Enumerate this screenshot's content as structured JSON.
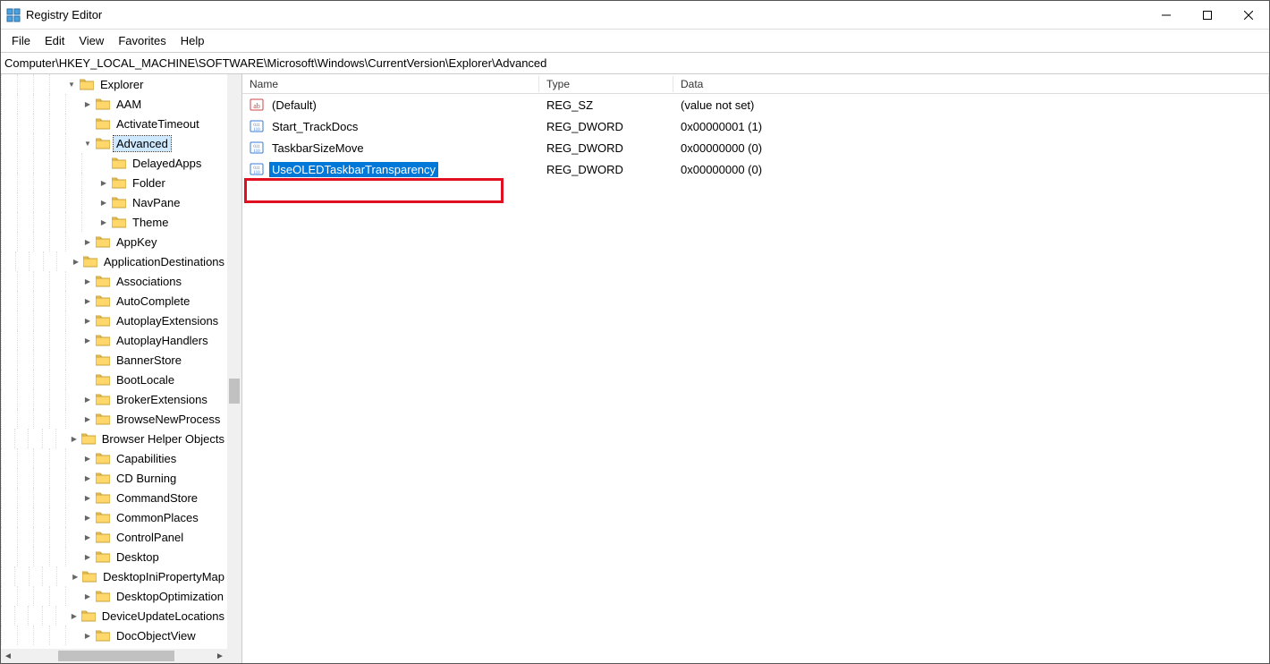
{
  "title": "Registry Editor",
  "menu": {
    "file": "File",
    "edit": "Edit",
    "view": "View",
    "favorites": "Favorites",
    "help": "Help"
  },
  "address": "Computer\\HKEY_LOCAL_MACHINE\\SOFTWARE\\Microsoft\\Windows\\CurrentVersion\\Explorer\\Advanced",
  "columns": {
    "name": "Name",
    "type": "Type",
    "data": "Data"
  },
  "tree": [
    {
      "depth": 4,
      "exp": "v",
      "label": "Explorer",
      "selected": false
    },
    {
      "depth": 5,
      "exp": ">",
      "label": "AAM"
    },
    {
      "depth": 5,
      "exp": "",
      "label": "ActivateTimeout"
    },
    {
      "depth": 5,
      "exp": "v",
      "label": "Advanced",
      "selected": true
    },
    {
      "depth": 6,
      "exp": "",
      "label": "DelayedApps"
    },
    {
      "depth": 6,
      "exp": ">",
      "label": "Folder"
    },
    {
      "depth": 6,
      "exp": ">",
      "label": "NavPane"
    },
    {
      "depth": 6,
      "exp": ">",
      "label": "Theme"
    },
    {
      "depth": 5,
      "exp": ">",
      "label": "AppKey"
    },
    {
      "depth": 5,
      "exp": ">",
      "label": "ApplicationDestinations"
    },
    {
      "depth": 5,
      "exp": ">",
      "label": "Associations"
    },
    {
      "depth": 5,
      "exp": ">",
      "label": "AutoComplete"
    },
    {
      "depth": 5,
      "exp": ">",
      "label": "AutoplayExtensions"
    },
    {
      "depth": 5,
      "exp": ">",
      "label": "AutoplayHandlers"
    },
    {
      "depth": 5,
      "exp": "",
      "label": "BannerStore"
    },
    {
      "depth": 5,
      "exp": "",
      "label": "BootLocale"
    },
    {
      "depth": 5,
      "exp": ">",
      "label": "BrokerExtensions"
    },
    {
      "depth": 5,
      "exp": ">",
      "label": "BrowseNewProcess"
    },
    {
      "depth": 5,
      "exp": ">",
      "label": "Browser Helper Objects"
    },
    {
      "depth": 5,
      "exp": ">",
      "label": "Capabilities"
    },
    {
      "depth": 5,
      "exp": ">",
      "label": "CD Burning"
    },
    {
      "depth": 5,
      "exp": ">",
      "label": "CommandStore"
    },
    {
      "depth": 5,
      "exp": ">",
      "label": "CommonPlaces"
    },
    {
      "depth": 5,
      "exp": ">",
      "label": "ControlPanel"
    },
    {
      "depth": 5,
      "exp": ">",
      "label": "Desktop"
    },
    {
      "depth": 5,
      "exp": ">",
      "label": "DesktopIniPropertyMap"
    },
    {
      "depth": 5,
      "exp": ">",
      "label": "DesktopOptimization"
    },
    {
      "depth": 5,
      "exp": ">",
      "label": "DeviceUpdateLocations"
    },
    {
      "depth": 5,
      "exp": ">",
      "label": "DocObjectView"
    }
  ],
  "values": [
    {
      "name": "(Default)",
      "type": "REG_SZ",
      "data": "(value not set)",
      "icon": "string",
      "selected": false
    },
    {
      "name": "Start_TrackDocs",
      "type": "REG_DWORD",
      "data": "0x00000001 (1)",
      "icon": "binary",
      "selected": false
    },
    {
      "name": "TaskbarSizeMove",
      "type": "REG_DWORD",
      "data": "0x00000000 (0)",
      "icon": "binary",
      "selected": false
    },
    {
      "name": "UseOLEDTaskbarTransparency",
      "type": "REG_DWORD",
      "data": "0x00000000 (0)",
      "icon": "binary",
      "selected": true
    }
  ]
}
